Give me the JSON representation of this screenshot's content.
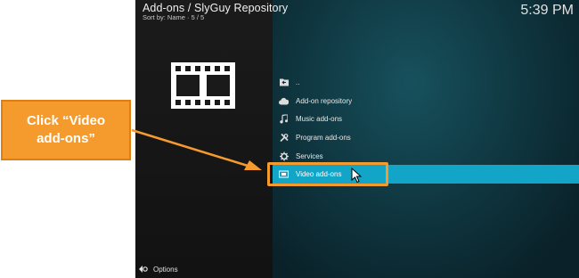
{
  "header": {
    "title": "Add-ons / SlyGuy Repository",
    "sort_info": "Sort by: Name  ·  5 / 5",
    "clock": "5:39 PM"
  },
  "menu": {
    "items": [
      {
        "label": "..",
        "icon": "folder-back-icon"
      },
      {
        "label": "Add-on repository",
        "icon": "cloud-icon"
      },
      {
        "label": "Music add-ons",
        "icon": "music-note-icon"
      },
      {
        "label": "Program add-ons",
        "icon": "tools-icon"
      },
      {
        "label": "Services",
        "icon": "gear-icon"
      },
      {
        "label": "Video add-ons",
        "icon": "video-icon",
        "selected": true
      }
    ]
  },
  "footer": {
    "options_label": "Options"
  },
  "annotation": {
    "callout_text": "Click “Video add-ons”"
  },
  "colors": {
    "accent": "#12a5c8",
    "annotation": "#f59b2d",
    "background": "#0c1b22"
  }
}
